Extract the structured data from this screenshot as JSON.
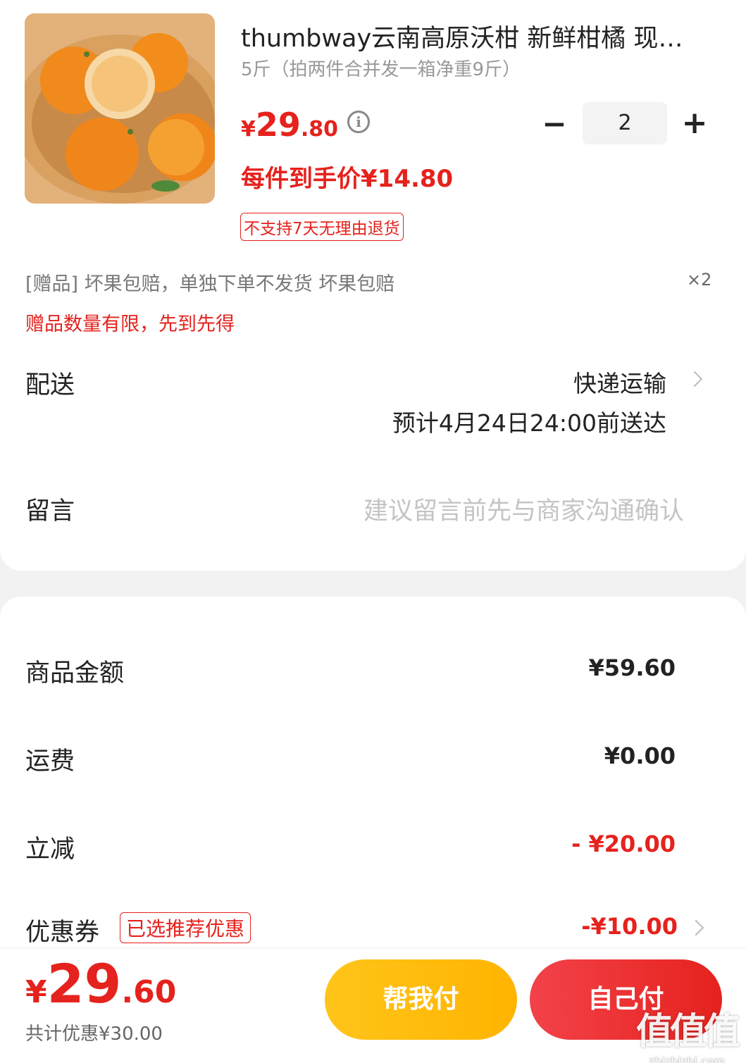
{
  "product": {
    "title": "thumbway云南高原沃柑 新鲜柑橘 现摘当季时令水果",
    "spec": "5斤（拍两件合并发一箱净重9斤）",
    "price_currency": "¥",
    "price_int": "29",
    "price_dec": ".80",
    "info_icon": "i",
    "quantity": "2",
    "minus_label": "−",
    "plus_label": "+",
    "per_item_price": "每件到手价¥14.80",
    "return_policy": "不支持7天无理由退货"
  },
  "gift": {
    "text": "[赠品]  坏果包赔，单独下单不发货 坏果包赔",
    "count": "×2",
    "note": "赠品数量有限，先到先得"
  },
  "shipping": {
    "label": "配送",
    "method": "快递运输",
    "eta": "预计4月24日24:00前送达"
  },
  "message": {
    "label": "留言",
    "placeholder": "建议留言前先与商家沟通确认"
  },
  "summary": {
    "goods_label": "商品金额",
    "goods_value": "¥59.60",
    "shipping_label": "运费",
    "shipping_value": "¥0.00",
    "discount_label": "立减",
    "discount_value": "- ¥20.00",
    "coupon_label": "优惠券",
    "coupon_tag": "已选推荐优惠",
    "coupon_value": "-¥10.00"
  },
  "footer": {
    "total_currency": "¥",
    "total_int": "29",
    "total_dec": ".60",
    "saved": "共计优惠¥30.00",
    "help_pay": "帮我付",
    "self_pay": "自己付"
  },
  "watermark": {
    "big": "值值值",
    "small": "zhizhizhi.com"
  },
  "colors": {
    "accent_red": "#e5221d",
    "accent_yellow": "#ffc41a"
  }
}
